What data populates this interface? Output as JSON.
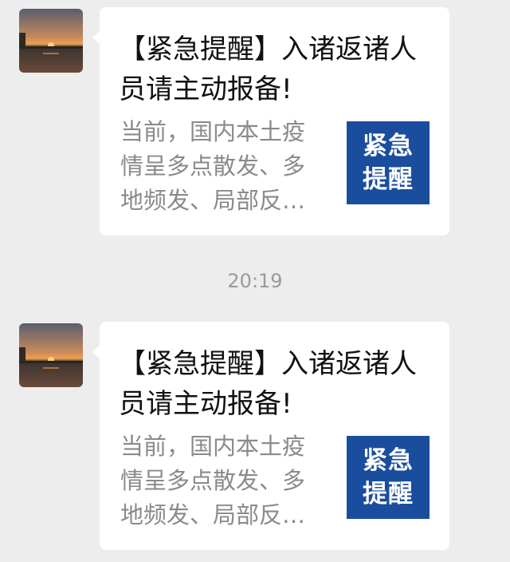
{
  "messages": [
    {
      "title": "【紧急提醒】入诸返诸人员请主动报备!",
      "desc": "当前，国内本土疫\n情呈多点散发、多\n地频发、局部反…",
      "thumb": {
        "line1": "紧急",
        "line2": "提醒"
      }
    },
    {
      "title": "【紧急提醒】入诸返诸人员请主动报备!",
      "desc": "当前，国内本土疫\n情呈多点散发、多\n地频发、局部反…",
      "thumb": {
        "line1": "紧急",
        "line2": "提醒"
      }
    }
  ],
  "timestamp": "20:19",
  "colors": {
    "background": "#ededed",
    "bubble": "#ffffff",
    "thumb": "#1a4d9e",
    "desc": "#8a8a8a"
  }
}
